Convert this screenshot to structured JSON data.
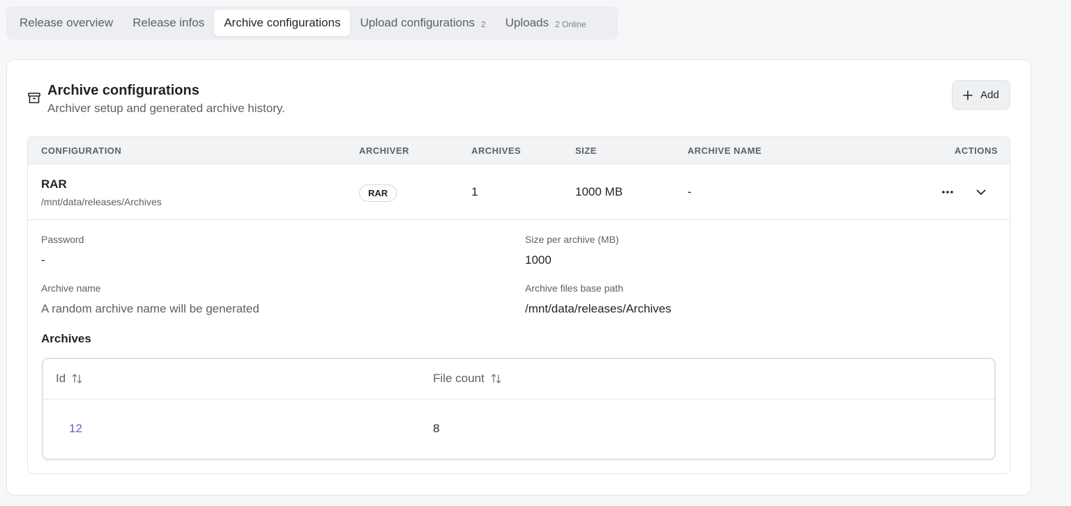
{
  "tabs": [
    {
      "label": "Release overview",
      "count": ""
    },
    {
      "label": "Release infos",
      "count": ""
    },
    {
      "label": "Archive configurations",
      "count": ""
    },
    {
      "label": "Upload configurations",
      "count": "2"
    },
    {
      "label": "Uploads",
      "count": "2 Online"
    }
  ],
  "active_tab": "Archive configurations",
  "card": {
    "title": "Archive configurations",
    "subtitle": "Archiver setup and generated archive history.",
    "add_label": "Add"
  },
  "config_table": {
    "headers": {
      "configuration": "CONFIGURATION",
      "archiver": "ARCHIVER",
      "archives": "ARCHIVES",
      "size": "SIZE",
      "archive_name": "ARCHIVE NAME",
      "actions": "ACTIONS"
    },
    "row": {
      "name": "RAR",
      "path": "/mnt/data/releases/Archives",
      "archiver": "RAR",
      "archives": "1",
      "size": "1000 MB",
      "archive_name": "-"
    }
  },
  "details": {
    "password_label": "Password",
    "password_value": "-",
    "size_label": "Size per archive (MB)",
    "size_value": "1000",
    "archive_name_label": "Archive name",
    "archive_name_value": "A random archive name will be generated",
    "base_path_label": "Archive files base path",
    "base_path_value": "/mnt/data/releases/Archives"
  },
  "archives": {
    "title": "Archives",
    "columns": [
      "Id",
      "File count"
    ],
    "rows": [
      {
        "id": "12",
        "file_count": "8"
      }
    ]
  },
  "colors": {
    "link": "#6a5acd",
    "border": "#e2e5e9",
    "header_bg": "#f2f3f5"
  }
}
